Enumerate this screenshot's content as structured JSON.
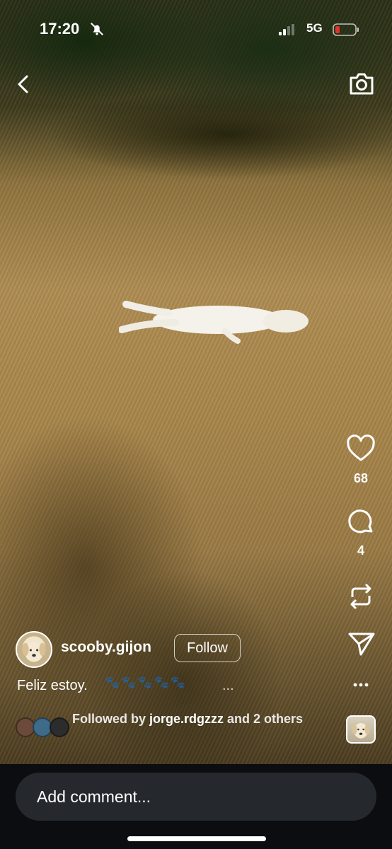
{
  "status_bar": {
    "time": "17:20",
    "network": "5G"
  },
  "post": {
    "username": "scooby.gijon",
    "follow_label": "Follow",
    "caption": "Feliz estoy.",
    "caption_more": "...",
    "followed_by_prefix": "Followed by ",
    "followed_by_name": "jorge.rdgzzz",
    "followed_by_suffix": " and 2 others"
  },
  "actions": {
    "likes": "68",
    "comments": "4"
  },
  "comment_bar": {
    "placeholder": "Add comment..."
  },
  "colors": {
    "battery_low": "#e0342b",
    "comment_field": "#25292e"
  },
  "icons": [
    "bell-muted-icon",
    "signal-icon",
    "battery-icon",
    "back-icon",
    "camera-icon",
    "heart-icon",
    "comment-icon",
    "repost-icon",
    "share-icon",
    "more-icon"
  ]
}
